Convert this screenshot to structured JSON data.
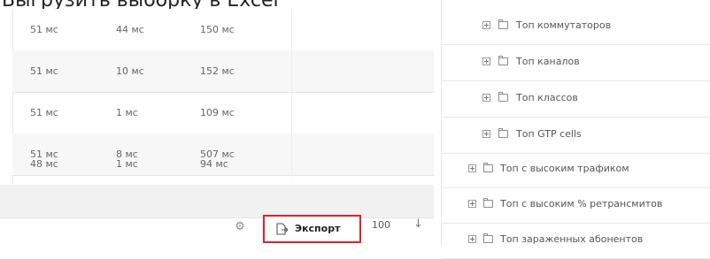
{
  "caption": "Выгрузить выборку в Excel",
  "table": {
    "rows": [
      [
        "51 мс",
        "44 мс",
        "150 мс"
      ],
      [
        "51 мс",
        "10 мс",
        "152 мс"
      ],
      [
        "51 мс",
        "1 мс",
        "109 мс"
      ],
      [
        "51 мс",
        "8 мс",
        "507 мс"
      ],
      [
        "48 мс",
        "1 мс",
        "94 мс"
      ]
    ]
  },
  "toolbar": {
    "settings_icon": "gear-icon",
    "export_icon": "export-file-icon",
    "export_label": "Экспорт",
    "page_size": "100",
    "sort_icon": "arrow-down-icon",
    "highlight_color": "#e3202a"
  },
  "tree": {
    "items": [
      {
        "label": "Топ коммутаторов",
        "level": 2
      },
      {
        "label": "Топ каналов",
        "level": 2
      },
      {
        "label": "Топ классов",
        "level": 2
      },
      {
        "label": "Топ GTP cells",
        "level": 2
      },
      {
        "label": "Топ с высоким трафиком",
        "level": 1
      },
      {
        "label": "Топ с высоким % ретрансмитов",
        "level": 1
      },
      {
        "label": "Топ зараженных абонентов",
        "level": 1
      }
    ]
  }
}
